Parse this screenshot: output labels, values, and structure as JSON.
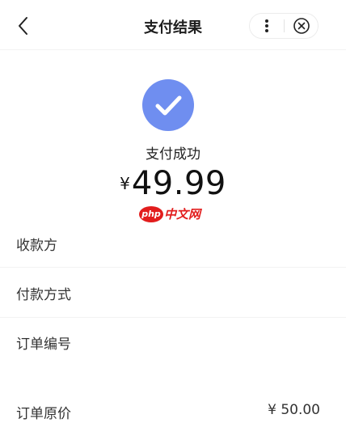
{
  "nav": {
    "title": "支付结果"
  },
  "result": {
    "status": "支付成功",
    "currency": "¥",
    "amount": "49.99"
  },
  "watermark": {
    "badge": "php",
    "text": "中文网"
  },
  "rows": [
    {
      "label": "收款方",
      "value": ""
    },
    {
      "label": "付款方式",
      "value": ""
    },
    {
      "label": "订单编号",
      "value": ""
    },
    {
      "label": "订单原价",
      "value": "¥ 50.00"
    }
  ],
  "colors": {
    "success_circle": "#6f8ef0",
    "watermark_red": "#e21d1d"
  }
}
